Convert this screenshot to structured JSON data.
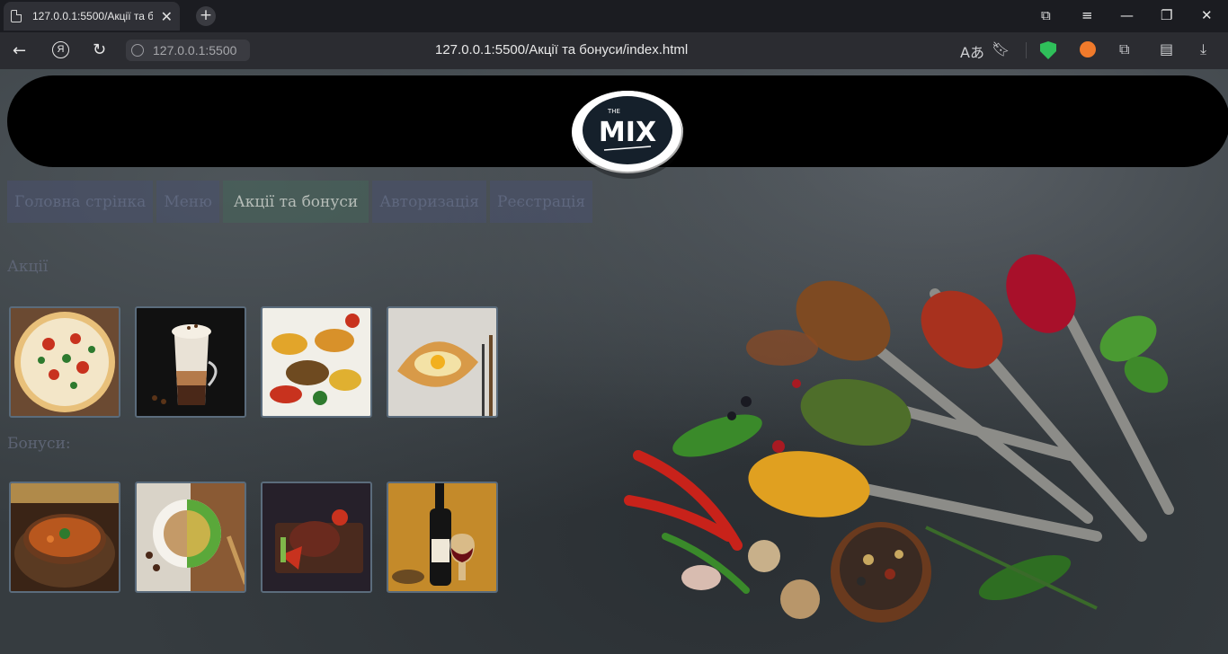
{
  "browser": {
    "tab_title": "127.0.0.1:5500/Акції та б",
    "tab_close": "✕",
    "new_tab": "+",
    "host": "127.0.0.1:5500",
    "url": "127.0.0.1:5500/Акції та бонуси/index.html",
    "window_controls": [
      "⧉",
      "≡",
      "—",
      "❐",
      "✕"
    ]
  },
  "header": {
    "logo_small": "THE",
    "logo_text": "MIX"
  },
  "nav": [
    {
      "label": "Головна стрінка",
      "active": false
    },
    {
      "label": "Меню",
      "active": false
    },
    {
      "label": "Акції та бонуси",
      "active": true
    },
    {
      "label": "Авторизація",
      "active": false
    },
    {
      "label": "Реєстрація",
      "active": false
    }
  ],
  "sections": {
    "promotions_title": "Акції",
    "bonuses_title": "Бонуси:"
  },
  "promotions": [
    {
      "icon": "pizza-image"
    },
    {
      "icon": "latte-image"
    },
    {
      "icon": "grilled-vegetables-image"
    },
    {
      "icon": "khachapuri-image"
    }
  ],
  "bonuses": [
    {
      "icon": "soup-image"
    },
    {
      "icon": "coffee-tea-image"
    },
    {
      "icon": "steak-image"
    },
    {
      "icon": "wine-image"
    }
  ],
  "colors": {
    "header_bg": "#000000",
    "nav_bg": "#48506e",
    "nav_active_bg": "#46645a",
    "thumb_border": "#5b6c7c",
    "shield_green": "#2fbf5a"
  }
}
